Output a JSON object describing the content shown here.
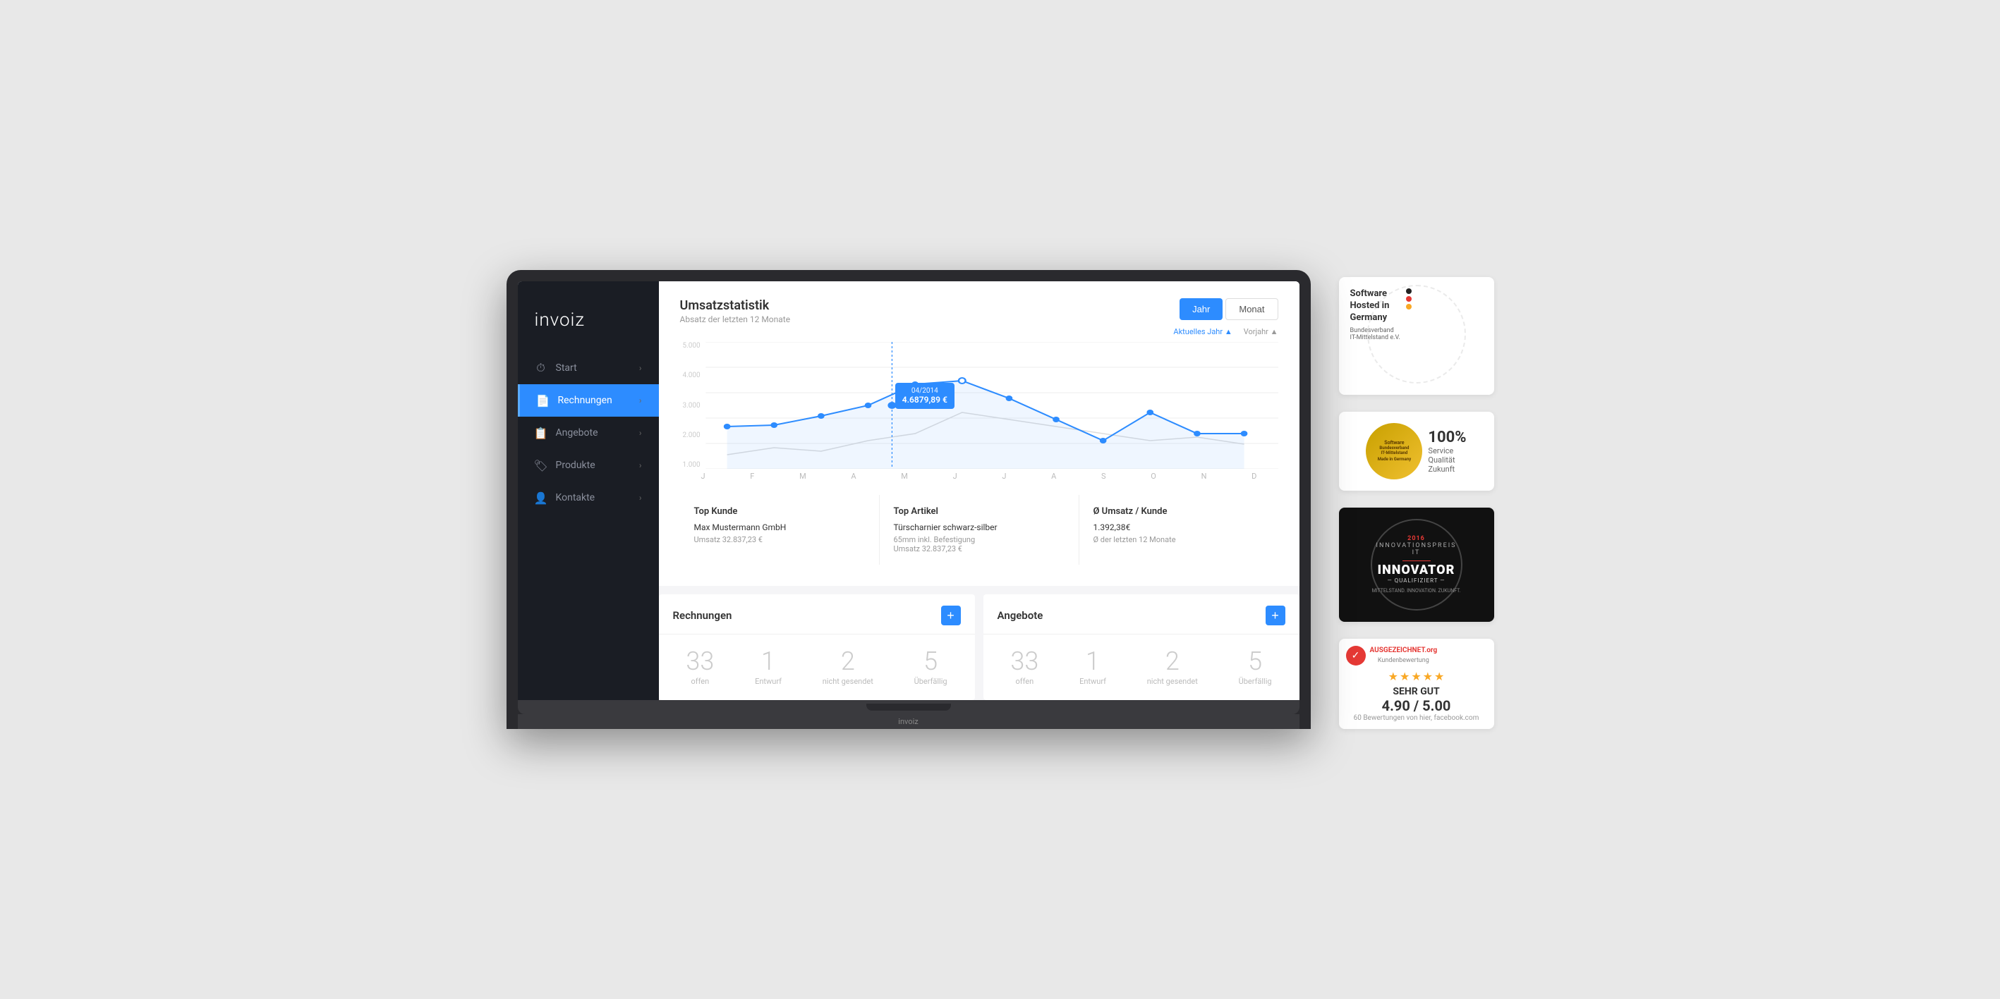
{
  "sidebar": {
    "logo": "invoiz",
    "items": [
      {
        "id": "start",
        "label": "Start",
        "icon": "⏱",
        "active": false
      },
      {
        "id": "rechnungen",
        "label": "Rechnungen",
        "icon": "📄",
        "active": true
      },
      {
        "id": "angebote",
        "label": "Angebote",
        "icon": "📋",
        "active": false
      },
      {
        "id": "produkte",
        "label": "Produkte",
        "icon": "🏷",
        "active": false
      },
      {
        "id": "kontakte",
        "label": "Kontakte",
        "icon": "👤",
        "active": false
      }
    ]
  },
  "stats": {
    "title": "Umsatzstatistik",
    "subtitle": "Absatz der letzten 12 Monate",
    "btn_year": "Jahr",
    "btn_month": "Monat",
    "legend_current": "Aktuelles Jahr ▲",
    "legend_prev": "Vorjahr ▲",
    "y_labels": [
      "5.000",
      "4.000",
      "3.000",
      "2.000",
      "1.000"
    ],
    "x_labels": [
      "J",
      "F",
      "M",
      "A",
      "M",
      "J",
      "J",
      "A",
      "S",
      "O",
      "N",
      "D"
    ],
    "tooltip": {
      "date": "04/2014",
      "value": "4.6879,89 €"
    }
  },
  "top_cards": [
    {
      "title": "Top Kunde",
      "main": "Max Mustermann GmbH",
      "sub": "Umsatz 32.837,23 €"
    },
    {
      "title": "Top Artikel",
      "main": "Türscharnier schwarz-silber",
      "sub2": "65mm inkl. Befestigung",
      "sub": "Umsatz 32.837,23 €"
    },
    {
      "title": "Ø Umsatz / Kunde",
      "main": "1.392,38€",
      "sub": "Ø der letzten 12 Monate"
    }
  ],
  "lower_cards": [
    {
      "title": "Rechnungen",
      "add_label": "+",
      "stats": [
        {
          "number": "33",
          "label": "offen"
        },
        {
          "number": "1",
          "label": "Entwurf"
        },
        {
          "number": "2",
          "label": "nicht gesendet"
        },
        {
          "number": "5",
          "label": "Überfällig"
        }
      ]
    },
    {
      "title": "Angebote",
      "add_label": "+",
      "stats": [
        {
          "number": "33",
          "label": "offen"
        },
        {
          "number": "1",
          "label": "Entwurf"
        },
        {
          "number": "2",
          "label": "nicht gesendet"
        },
        {
          "number": "5",
          "label": "Überfällig"
        }
      ]
    }
  ],
  "badges": {
    "germany": {
      "title": "Software\nHosted in\nGermany",
      "subtitle": "Bundesverband\nIT-Mittelstand e.V."
    },
    "quality": {
      "pct": "100%",
      "items": [
        "Service",
        "Qualität",
        "Zukunft"
      ]
    },
    "innovator": {
      "year": "2016",
      "label1": "INNOVATOR",
      "label2": "— QUALIFIZIERT —"
    },
    "rating": {
      "logo": "AUSGEZEICHNET.org",
      "label": "Kundenbewertung",
      "sehr_gut": "SEHR GUT",
      "score": "4.90 / 5.00",
      "reviews": "60 Bewertungen\nvon hier, facebook.com"
    }
  },
  "laptop_brand": "invoiz"
}
